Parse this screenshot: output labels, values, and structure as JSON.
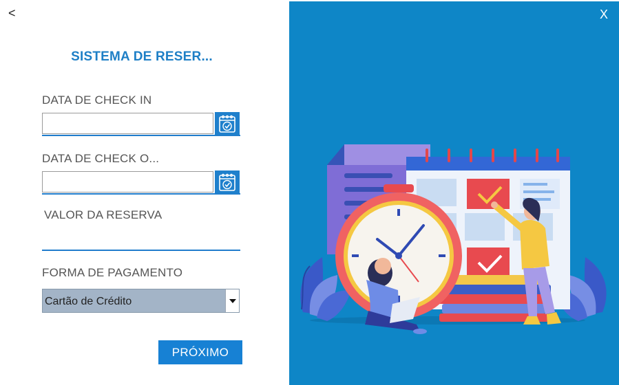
{
  "nav": {
    "back_label": "<",
    "close_label": "X"
  },
  "title": "SISTEMA DE RESER...",
  "form": {
    "check_in_label": "DATA DE CHECK IN",
    "check_in_value": "",
    "check_out_label": "DATA DE CHECK O...",
    "check_out_value": "",
    "valor_label": "VALOR DA RESERVA",
    "valor_value": "",
    "pagamento_label": "FORMA DE PAGAMENTO",
    "pagamento_selected": "Cartão de Crédito"
  },
  "next_button": "PRÓXIMO",
  "icons": {
    "calendar": "calendar-check-icon",
    "dropdown": "triangle-down-icon",
    "illustration": "reservation-calendar-clock-illustration"
  },
  "colors": {
    "accent": "#1e7fc6",
    "panel": "#0e86c7",
    "button": "#1781d4",
    "select_bg": "#a3b4c7"
  }
}
